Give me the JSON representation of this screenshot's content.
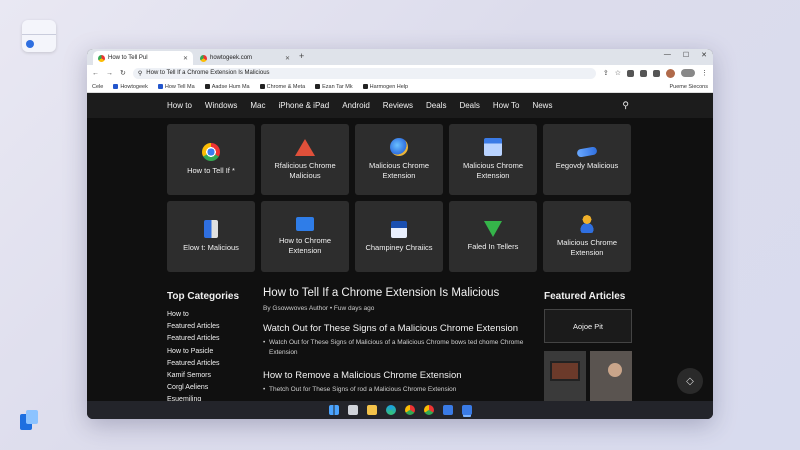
{
  "browser": {
    "tabs": [
      {
        "label": "How to Tell Pul",
        "active": true
      },
      {
        "label": "howtogeek.com",
        "active": false
      }
    ],
    "address": "How to Tell If a Chrome Extension Is Malicious",
    "bookmarks": [
      "Cele",
      "Howtogeek",
      "How Tell Ma",
      "Aadse Hum Ma",
      "Chrome & Meta",
      "Ezan Tar Mk",
      "Harmogen Help"
    ],
    "bookmarks_right": "Pueme Siecons"
  },
  "nav": {
    "items": [
      "How to",
      "Windows",
      "Mac",
      "iPhone & iPad",
      "Android",
      "Reviews",
      "Deals",
      "Deals",
      "How To",
      "News"
    ]
  },
  "cards": [
    {
      "label": "How to Tell If *",
      "icon": "chrome-icon"
    },
    {
      "label": "Rfalicious Chrome Malicious",
      "icon": "warning-icon"
    },
    {
      "label": "Malicious Chrome Extension",
      "icon": "globe-icon"
    },
    {
      "label": "Malicious Chrome Extension",
      "icon": "window-icon"
    },
    {
      "label": "Eegovdy Malicious",
      "icon": "pen-icon"
    },
    {
      "label": "Elow t: Malicious",
      "icon": "phone-icon"
    },
    {
      "label": "How to Chrome Extension",
      "icon": "briefcase-icon"
    },
    {
      "label": "Champiney Chraiics",
      "icon": "box-icon"
    },
    {
      "label": "Faled In Tellers",
      "icon": "download-icon"
    },
    {
      "label": "Malicious Chrome Extension",
      "icon": "person-icon"
    }
  ],
  "categories": {
    "title": "Top Categories",
    "items": [
      "How to",
      "Featured Articles",
      "Featured Articles",
      "How to Pasicle",
      "Featured Articles",
      "Kamif Semors",
      "Corgl Aeliens",
      "Esuemiling"
    ]
  },
  "article": {
    "title": "How to Tell If a Chrome Extension Is Malicious",
    "byline": "By Gsowwoves Author • Fuw days ago",
    "h2_1": "Watch Out for These Signs of a Malicious Chrome Extension",
    "bullet_1": "Watch Out for These Signs of Malicious of a Malicious Chrome bows ted chome Chrome Extension",
    "h2_2": "How to Remove a Malicious Chrome Extension",
    "bullet_2": "Thetch Out for These Signs of rod a Malicious Chrome Extension"
  },
  "featured": {
    "title": "Featured Articles",
    "box_label": "Aojoe Pit"
  }
}
